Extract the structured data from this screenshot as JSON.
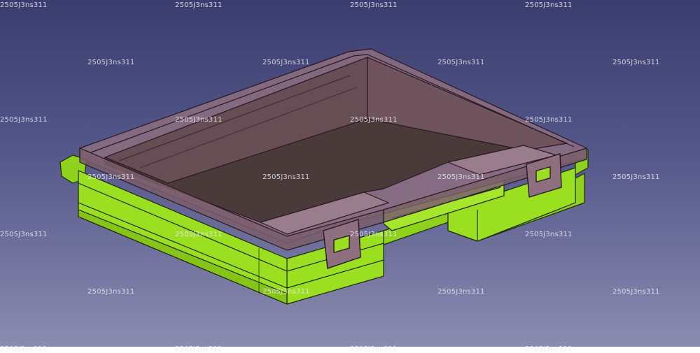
{
  "viewport": {
    "background_top": "#3a3d6e",
    "background_bottom": "#8a8cb0"
  },
  "model": {
    "parts": [
      "lid",
      "base",
      "latch-left",
      "latch-right"
    ],
    "colors": {
      "base": "#9be020",
      "base_edge": "#1e2a06",
      "lid": "#8d6f80",
      "lid_edge": "#2a1820",
      "interior": "#4a3a3a"
    }
  },
  "watermark": {
    "text": "2505J3ns311"
  }
}
